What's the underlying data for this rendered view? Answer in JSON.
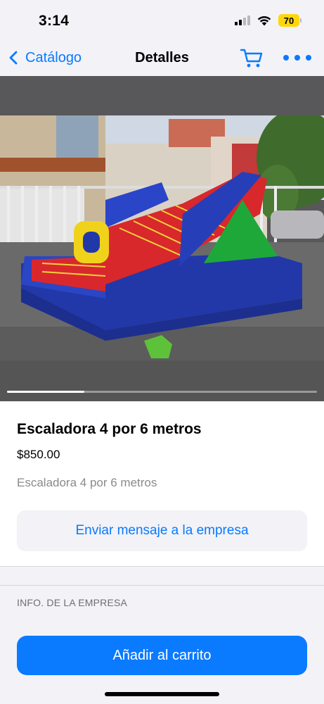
{
  "status_bar": {
    "time": "3:14",
    "battery": "70"
  },
  "nav": {
    "back_label": "Catálogo",
    "title": "Detalles",
    "cart_icon": "cart-icon",
    "more_icon": "ellipsis-icon"
  },
  "gallery": {
    "current_page_fraction": 0.25
  },
  "product": {
    "title": "Escaladora 4 por 6 metros",
    "price": "$850.00",
    "description": "Escaladora 4 por 6 metros"
  },
  "actions": {
    "message_label": "Enviar mensaje a la empresa",
    "add_to_cart_label": "Añadir al carrito"
  },
  "company_section": {
    "header": "INFO. DE LA EMPRESA"
  },
  "colors": {
    "accent": "#0a7aff",
    "background": "#f2f2f7",
    "battery": "#ffd60a"
  }
}
